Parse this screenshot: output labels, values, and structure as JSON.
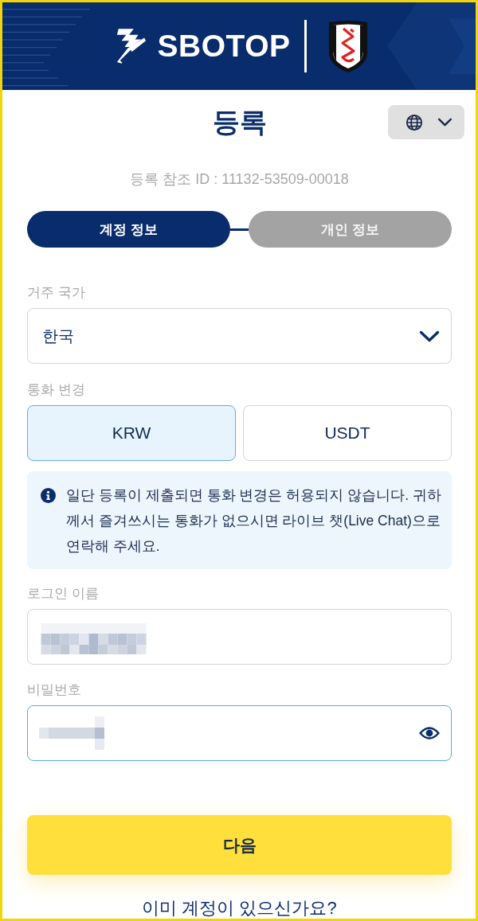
{
  "header": {
    "brand": "SBOTOP"
  },
  "title": "등록",
  "reference_id": "등록 참조 ID : 11132-53509-00018",
  "steps": [
    {
      "label": "계정 정보",
      "selected": true
    },
    {
      "label": "개인 정보",
      "selected": false
    }
  ],
  "form": [
    {
      "kind": "select",
      "label": "거주 국가",
      "value": "한국"
    },
    {
      "kind": "options",
      "label": "통화 변경",
      "options": [
        {
          "label": "KRW",
          "selected": true
        },
        {
          "label": "USDT",
          "selected": false
        }
      ]
    },
    {
      "kind": "notice",
      "text": "일단 등록이 제출되면 통화 변경은 허용되지 않습니다. 귀하께서 즐겨쓰시는 통화가 없으시면 라이브 챗(Live Chat)으로 연락해 주세요."
    },
    {
      "kind": "text",
      "label": "로그인 이름",
      "redacted": true,
      "focused": false
    },
    {
      "kind": "password",
      "label": "비밀번호",
      "redacted": true,
      "focused": true
    }
  ],
  "next_button": "다음",
  "login_prompt": "이미 계정이 있으신가요?"
}
